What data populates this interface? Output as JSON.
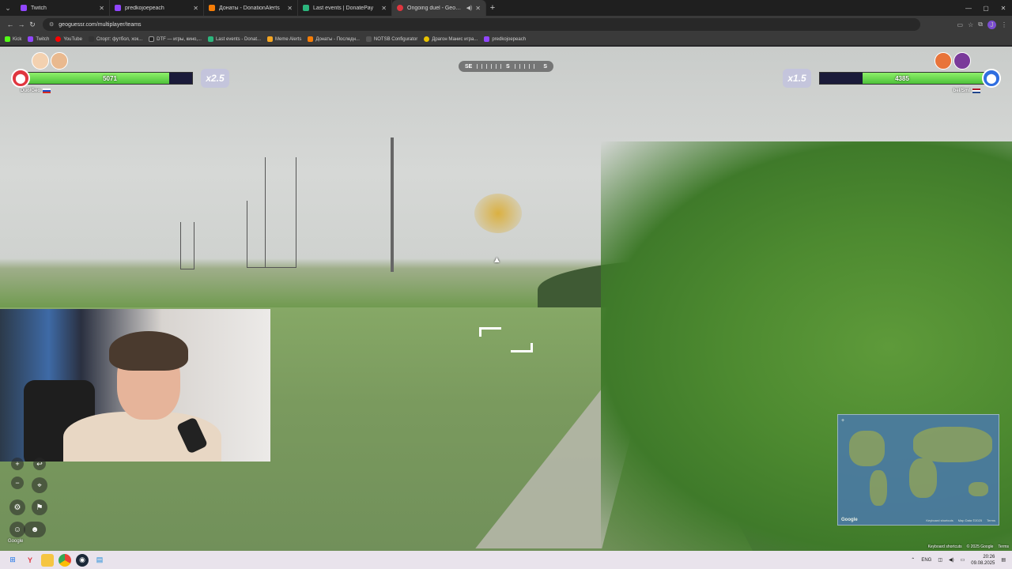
{
  "browser": {
    "tabs": [
      {
        "label": "Twitch",
        "color": "#9146ff",
        "active": false
      },
      {
        "label": "predkojoepeach",
        "color": "#9146ff",
        "active": false
      },
      {
        "label": "Донаты - DonationAlerts",
        "color": "#f57d07",
        "active": false
      },
      {
        "label": "Last events | DonatePay",
        "color": "#2cb67d",
        "active": false
      },
      {
        "label": "Ongoing duel - GeoGuessr",
        "color": "#e0363f",
        "active": true
      }
    ],
    "new_tab": "+",
    "url": "geoguessr.com/multiplayer/teams",
    "bookmarks": [
      {
        "label": "Kick",
        "color": "#53fc18"
      },
      {
        "label": "Twitch",
        "color": "#9146ff"
      },
      {
        "label": "YouTube",
        "color": "#ff0000"
      },
      {
        "label": "Спорт: футбол, хок...",
        "color": "#333333"
      },
      {
        "label": "DTF — игры, кино,...",
        "color": "#222222"
      },
      {
        "label": "Last events - Donat...",
        "color": "#2cb67d"
      },
      {
        "label": "Meme Alerts",
        "color": "#f5a623"
      },
      {
        "label": "Донаты - Последн...",
        "color": "#f57d07"
      },
      {
        "label": "NOTSB Configurator",
        "color": "#555555"
      },
      {
        "label": "Драгон Манис игра...",
        "color": "#e8c200"
      },
      {
        "label": "predkojoepeach",
        "color": "#9146ff"
      }
    ]
  },
  "game": {
    "left_team": {
      "health": "5071",
      "health_fraction": 0.86,
      "multiplier": "x2.5",
      "name": "Duo/Geo"
    },
    "right_team": {
      "health": "4385",
      "health_fraction": 0.74,
      "multiplier": "x1.5",
      "name": "bel/Sml"
    },
    "compass": {
      "left": "SE",
      "center": "S",
      "right": "S"
    },
    "google_label": "Google",
    "minimap_google": "Google",
    "minimap_legal": [
      "Keyboard shortcuts",
      "Map Data ©2025",
      "Terms"
    ],
    "footer_legal": [
      "Keyboard shortcuts",
      "© 2025 Google",
      "Terms"
    ]
  },
  "taskbar": {
    "lang": "ENG",
    "time": "20:26",
    "date": "09.08.2025"
  }
}
